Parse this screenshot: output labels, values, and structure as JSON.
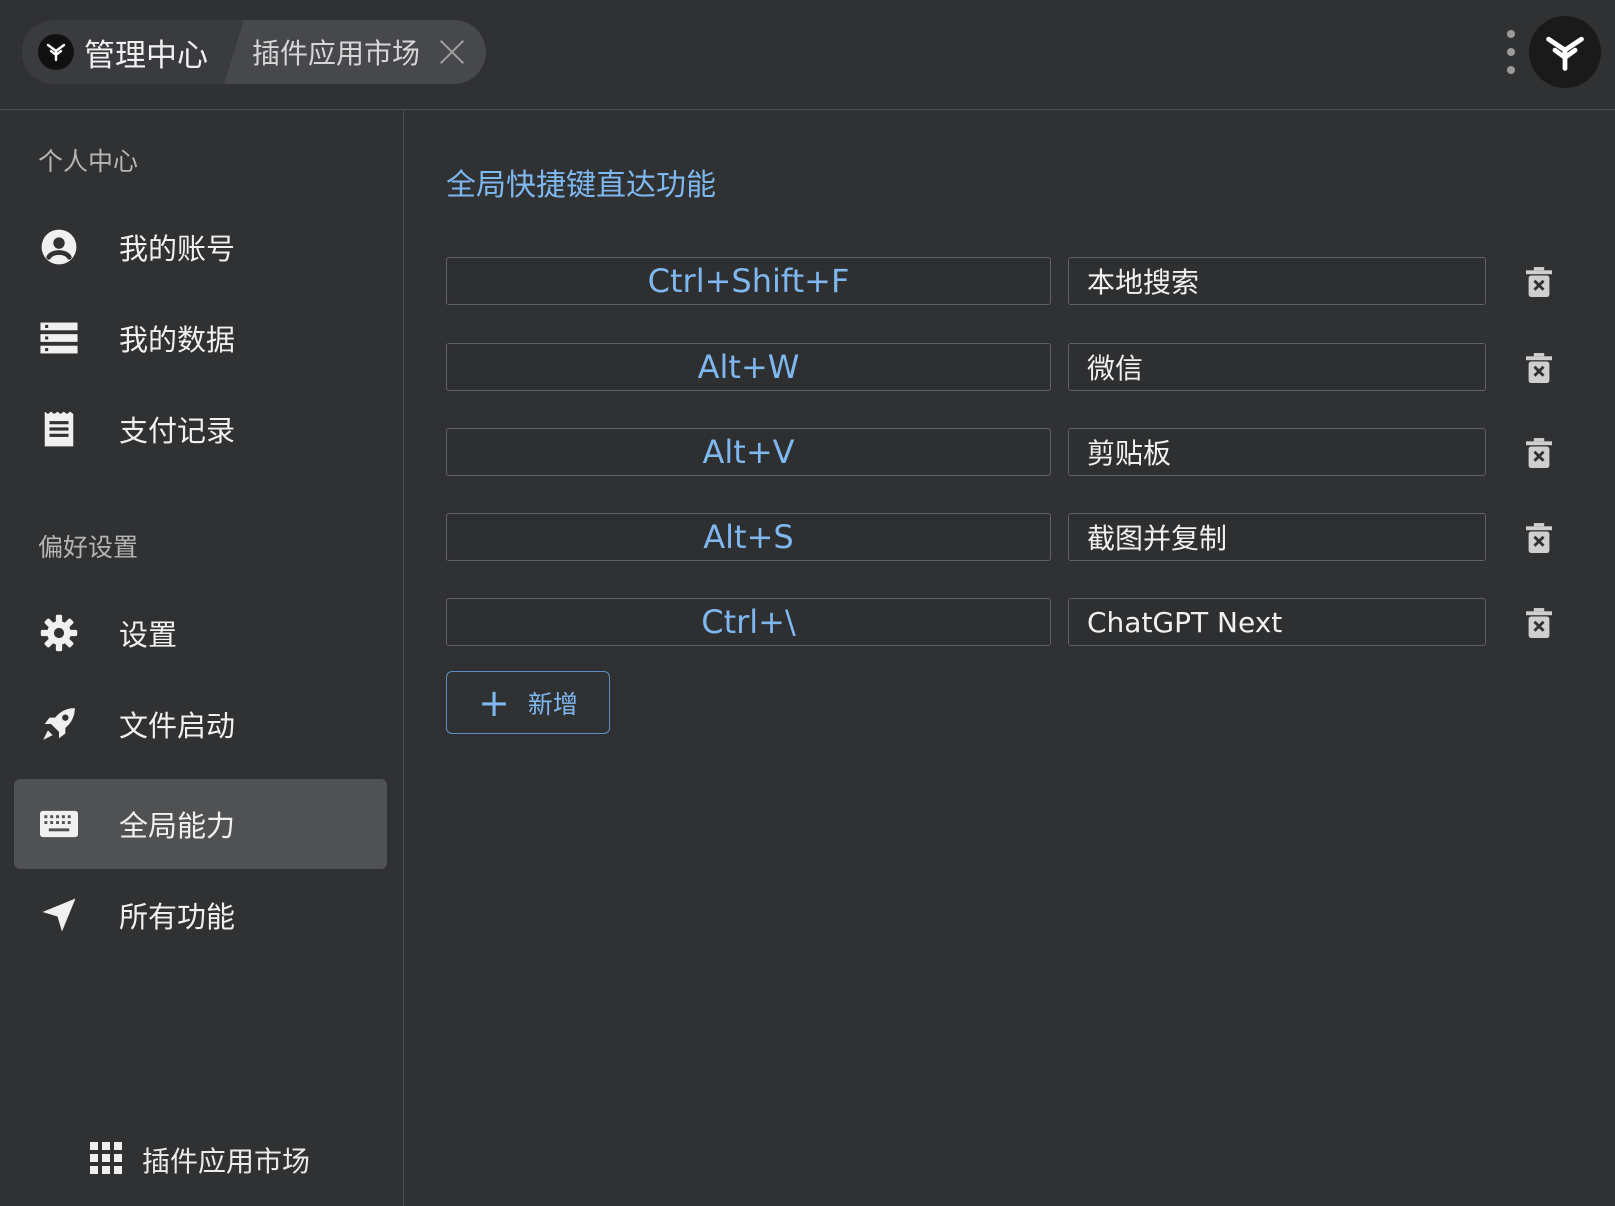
{
  "header": {
    "home_title": "管理中心",
    "tab_title": "插件应用市场",
    "icons": {
      "logo": "app-logo-icon",
      "close": "close-icon",
      "more": "more-vertical-icon"
    }
  },
  "sidebar": {
    "section_personal": "个人中心",
    "section_preferences": "偏好设置",
    "items": [
      {
        "label": "我的账号",
        "icon": "account-circle-icon"
      },
      {
        "label": "我的数据",
        "icon": "data-list-icon"
      },
      {
        "label": "支付记录",
        "icon": "receipt-icon"
      },
      {
        "label": "设置",
        "icon": "gear-icon"
      },
      {
        "label": "文件启动",
        "icon": "rocket-icon"
      },
      {
        "label": "全局能力",
        "icon": "keyboard-icon",
        "active": true
      },
      {
        "label": "所有功能",
        "icon": "navigation-arrow-icon"
      }
    ],
    "market_label": "插件应用市场"
  },
  "main": {
    "title": "全局快捷键直达功能",
    "shortcuts": [
      {
        "keys": "Ctrl+Shift+F",
        "action": "本地搜索"
      },
      {
        "keys": "Alt+W",
        "action": "微信"
      },
      {
        "keys": "Alt+V",
        "action": "剪贴板"
      },
      {
        "keys": "Alt+S",
        "action": "截图并复制"
      },
      {
        "keys": "Ctrl+\\",
        "action": "ChatGPT Next"
      }
    ],
    "add_label": "新增"
  },
  "colors": {
    "accent": "#7fb7ef",
    "background": "#303133",
    "active_item": "#505153"
  }
}
